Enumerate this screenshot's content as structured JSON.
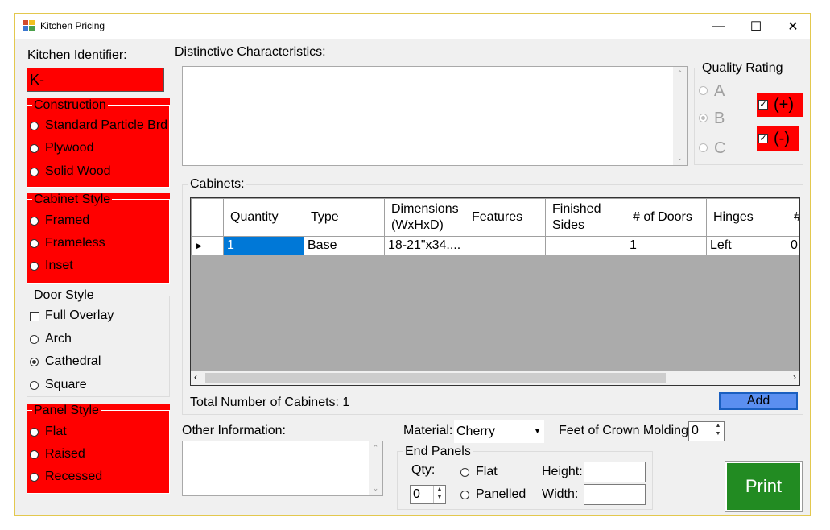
{
  "window": {
    "title": "Kitchen Pricing",
    "minimize": "—",
    "maximize": "☐",
    "close": "✕"
  },
  "kitchen_identifier": {
    "label": "Kitchen Identifier:",
    "value": "K-"
  },
  "construction": {
    "title": "Construction",
    "options": [
      "Standard Particle Brd",
      "Plywood",
      "Solid Wood"
    ]
  },
  "cabinet_style": {
    "title": "Cabinet Style",
    "options": [
      "Framed",
      "Frameless",
      "Inset"
    ]
  },
  "door_style": {
    "title": "Door Style",
    "full_overlay": "Full Overlay",
    "options": [
      "Arch",
      "Cathedral",
      "Square"
    ],
    "selected": "Cathedral"
  },
  "panel_style": {
    "title": "Panel Style",
    "options": [
      "Flat",
      "Raised",
      "Recessed"
    ]
  },
  "distinctive": {
    "label": "Distinctive Characteristics:",
    "value": ""
  },
  "quality": {
    "title": "Quality Rating",
    "options": [
      "A",
      "B",
      "C"
    ],
    "selected": "B",
    "plus": "(+)",
    "minus": "(-)"
  },
  "cabinets": {
    "label": "Cabinets:",
    "columns": [
      "Quantity",
      "Type",
      "Dimensions (WxHxD)",
      "Features",
      "Finished Sides",
      "# of Doors",
      "Hinges",
      "# D"
    ],
    "rows": [
      [
        "1",
        "Base",
        "18-21\"x34....",
        "",
        "",
        "1",
        "Left",
        "0"
      ]
    ],
    "total_label": "Total Number of Cabinets: 1",
    "add_button": "Add"
  },
  "other_info": {
    "label": "Other Information:",
    "value": ""
  },
  "material": {
    "label": "Material:",
    "value": "Cherry"
  },
  "crown": {
    "label": "Feet of Crown Molding",
    "value": "0"
  },
  "end_panels": {
    "title": "End Panels",
    "qty_label": "Qty:",
    "qty_value": "0",
    "flat": "Flat",
    "panelled": "Panelled",
    "height_label": "Height:",
    "width_label": "Width:"
  },
  "print_button": "Print",
  "colors": {
    "required": "#ff0000",
    "add_button": "#5b8ff0",
    "print_button": "#228b22",
    "selection": "#0078d7"
  }
}
